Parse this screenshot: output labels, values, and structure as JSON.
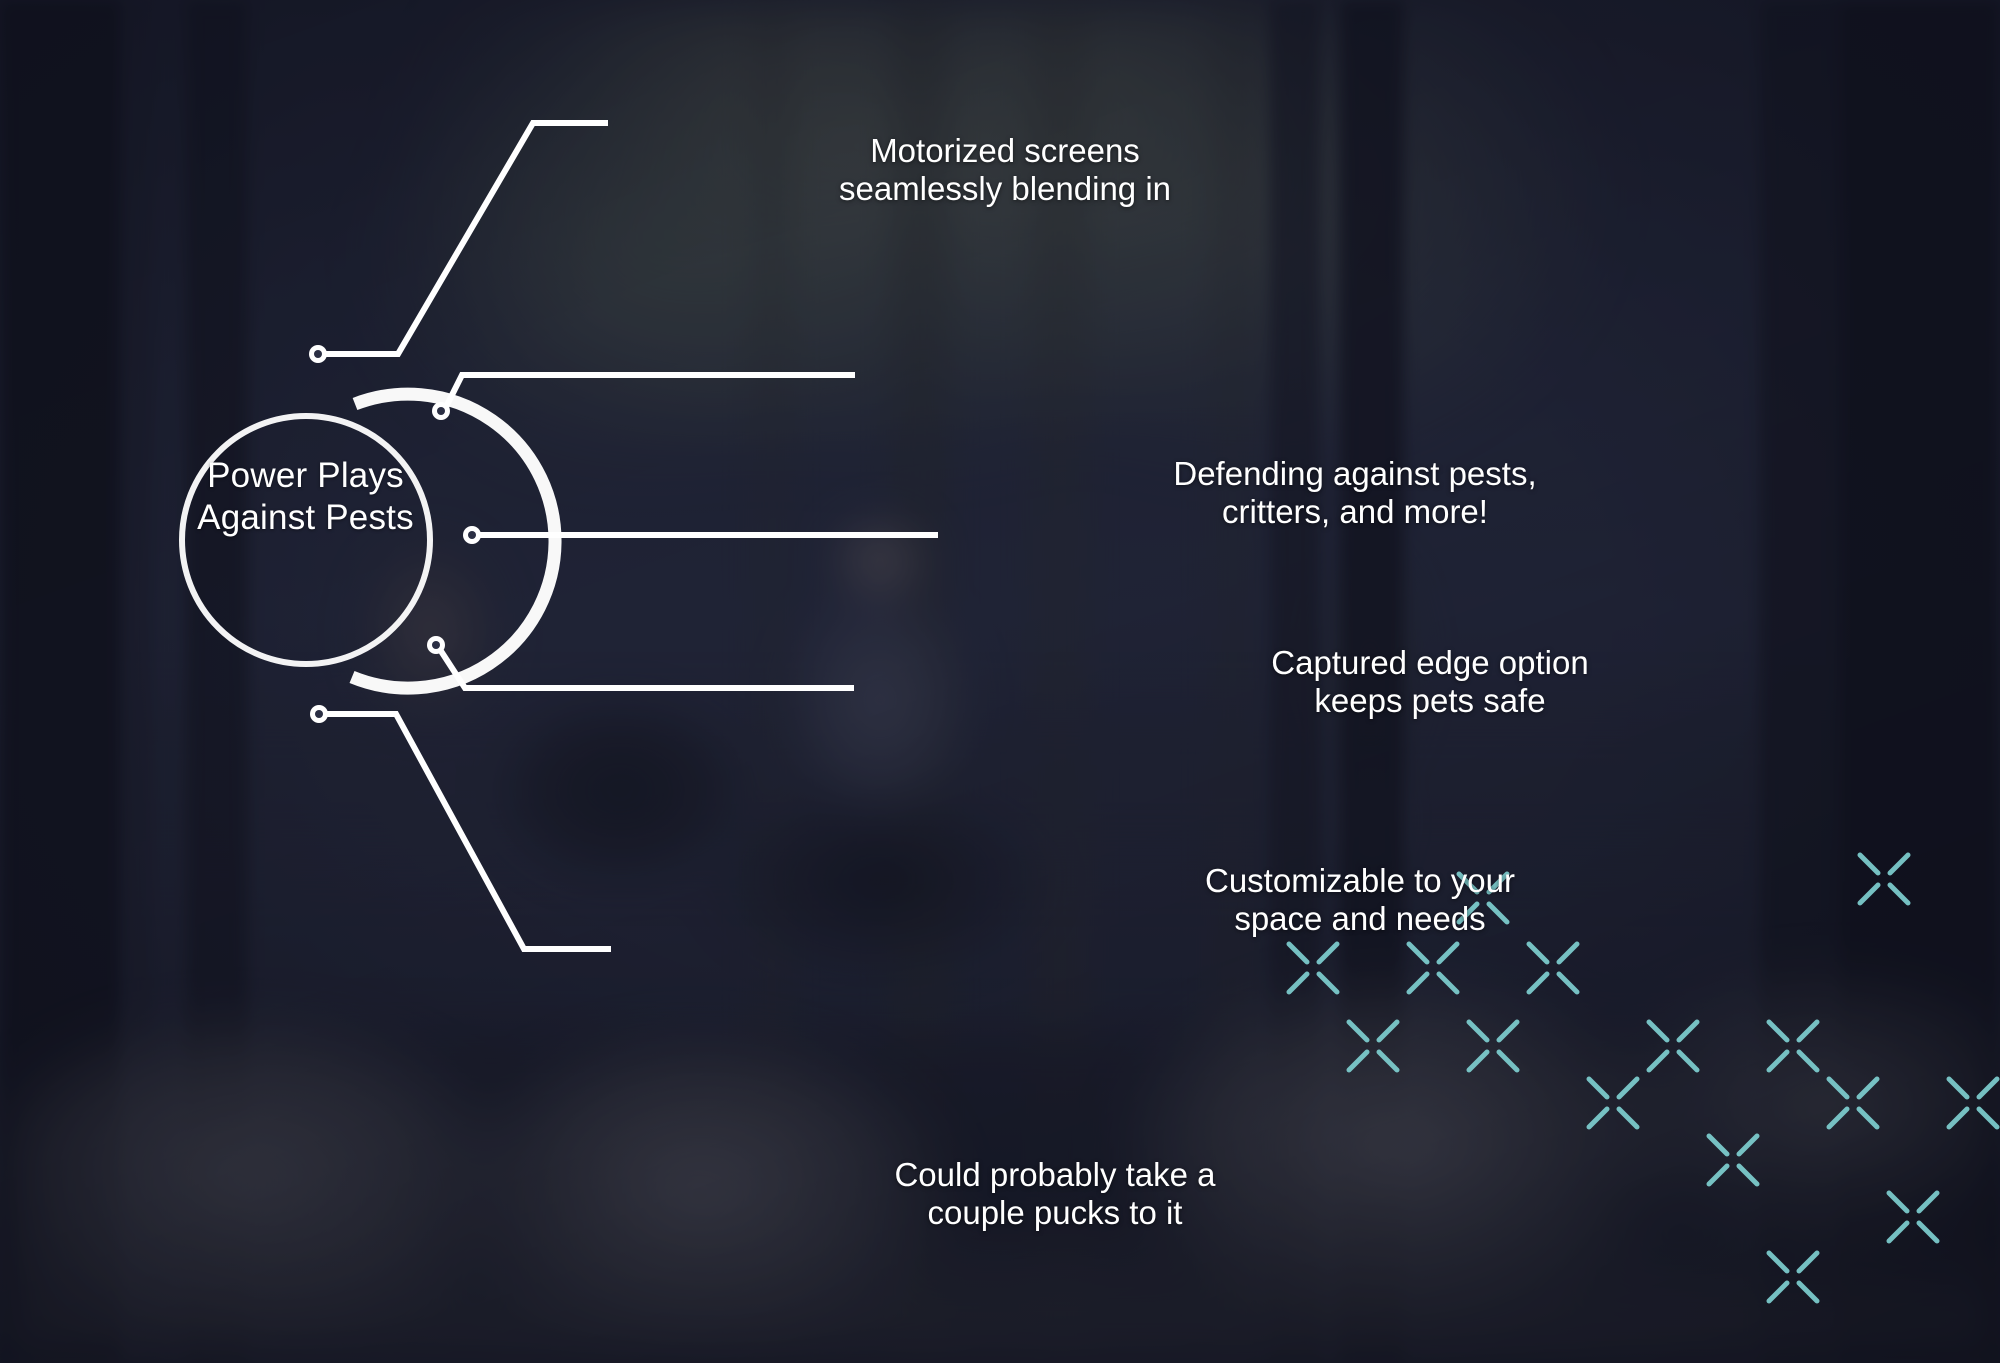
{
  "graphic": {
    "type": "radial-callout-infographic",
    "accent_color": "#7ecfd0",
    "line_color": "#ffffff",
    "text_color": "#ffffff",
    "background": "blurred photo of a living room interior with large windows, seated people and foliage outside, covered by a dark navy tint"
  },
  "hub": {
    "title_lines": [
      "Power Plays",
      "Against",
      "Pests"
    ],
    "line1": "Power Plays",
    "line2": "Against",
    "line3": "Pests"
  },
  "callouts": [
    {
      "id": "motorized-screens",
      "line1": "Motorized screens",
      "line2": "seamlessly blending in"
    },
    {
      "id": "defending-pests",
      "line1": "Defending against pests,",
      "line2": "critters, and more!"
    },
    {
      "id": "captured-edge",
      "line1": "Captured edge option",
      "line2": "keeps pets safe"
    },
    {
      "id": "customizable",
      "line1": "Customizable to your",
      "line2": "space and needs"
    },
    {
      "id": "puck-resistant",
      "line1": "Could probably take a",
      "line2": "couple pucks to it"
    }
  ],
  "decoration": {
    "x_pattern_color": "#7ecfd0",
    "x_pattern_count": 11
  }
}
